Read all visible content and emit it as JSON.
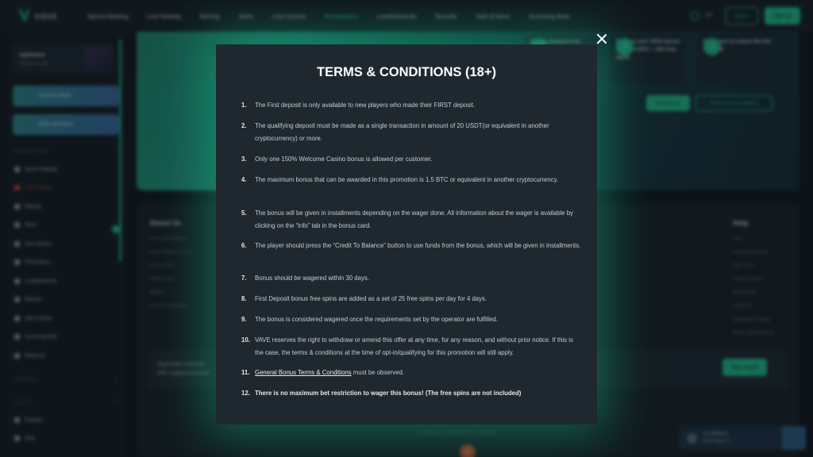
{
  "header": {
    "logo_text": "vave",
    "nav": [
      "Sports Betting",
      "Live betting",
      "Racing",
      "Slots",
      "Live Casino",
      "Promotions",
      "Leaderboards",
      "Results",
      "Hall of fame",
      "Incoming Bets"
    ],
    "active_nav": "Promotions",
    "lang": "EN",
    "login_label": "Log in",
    "signup_label": "Sign up"
  },
  "sidebar": {
    "app_title": "Application",
    "app_sub": "Download our app!",
    "promos": [
      "Fortune wheel",
      "Refer and Earn"
    ],
    "navigation_heading": "NAVIGATION",
    "items": [
      "Sports Betting",
      "Live betting",
      "Racing",
      "Slots",
      "Live Casino",
      "Promotions",
      "Leaderboards",
      "Results",
      "Hall of fame",
      "Incoming Bets",
      "Referrals"
    ],
    "sports_heading": "SPORTS",
    "slots_heading": "SLOTS",
    "slot_items": [
      "Popular",
      "New"
    ]
  },
  "hero": {
    "cards": [
      {
        "text": "Make a deposit of at",
        "num": "1"
      },
      {
        "text": "Receive your 150% bonus up to 1.5 BTC + 100 Free Spins",
        "num": "2"
      },
      {
        "text": "Play slots to unlock the full amount!",
        "num": "3"
      }
    ],
    "get_bonus": "Get bonus",
    "terms_btn": "Terms and conditions"
  },
  "footer": {
    "about_heading": "About Us",
    "about_links": [
      "Terms and Conditions",
      "General Bonuses Terms",
      "Privacy Policy",
      "Additional Info",
      "Affiliates",
      "Sources of Information"
    ],
    "help_heading": "Help",
    "help_links": [
      "FAQ",
      "General Sportsbook",
      "Help Center",
      "Crypto Explained",
      "Betting Rules",
      "Contact Us",
      "Responsible Gaming",
      "About Cryptocurrencies"
    ],
    "payments_line1": "Payments methods",
    "payments_line2": "with cryptocurrencies",
    "buy_crypto": "Buy crypto",
    "gambling_note": "Gambling can be addictive. Play responsibly.",
    "age": "18+"
  },
  "chat": {
    "user": "user3b0b4es",
    "question": "when does it ?"
  },
  "modal": {
    "title": "TERMS & CONDITIONS (18+)",
    "terms": [
      {
        "num": "1.",
        "text": "The First deposit is only available to new players who made their FIRST deposit."
      },
      {
        "num": "2.",
        "text": "The qualifying deposit must be made as a single transaction in amount of 20 USDT(or equivalent in another cryptocurrency) or more."
      },
      {
        "num": "3.",
        "text": "Only one 150% Welcome Casino bonus is allowed per customer."
      },
      {
        "num": "4.",
        "text": "The maximum bonus that can be awarded in this promotion is 1.5 BTC or equivalent in another cryptocurrency."
      },
      {
        "num": "5.",
        "text": "The bonus will be given in installments depending on the wager done. All information about the wager is available by clicking on the “info” tab in the bonus card."
      },
      {
        "num": "6.",
        "text": "The player should press the “Credit To Balance” button to use funds from the bonus, which will be given in installments."
      },
      {
        "num": "7.",
        "text": "Bonus should be wagered within 30 days."
      },
      {
        "num": "8.",
        "text": "First Deposit bonus free spins are added as a set of 25 free spins per day for 4 days."
      },
      {
        "num": "9.",
        "text": "The bonus is considered wagered once the requirements set by the operator are fulfilled."
      },
      {
        "num": "10.",
        "text": "VAVE reserves the right to withdraw or amend this offer at any time, for any reason, and without prior notice. If this is the case, the terms & conditions at the time of opt-in/qualifying for this promotion will still apply."
      },
      {
        "num": "11.",
        "link": "General Bonus Terms & Conditions",
        "text": " must be observed."
      },
      {
        "num": "12.",
        "text": "There is no maximum bet restriction to wager this bonus! (The free spins are not included)"
      }
    ]
  }
}
